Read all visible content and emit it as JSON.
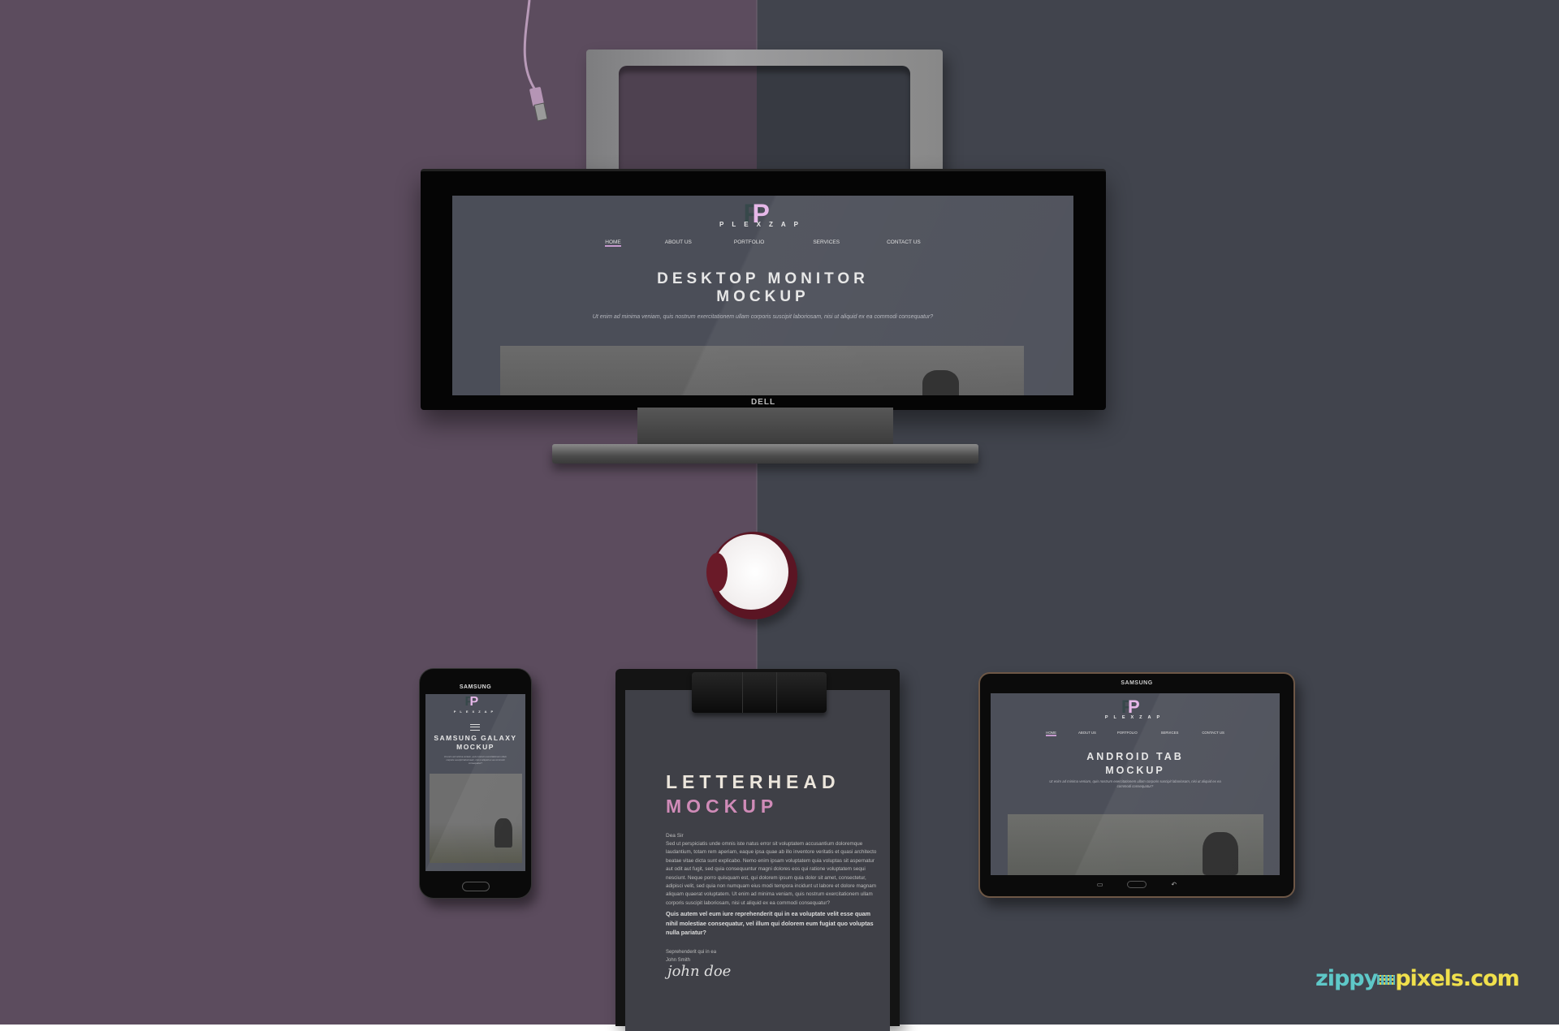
{
  "background": {
    "left_color": "#5c4c5e",
    "right_color": "#41444d"
  },
  "brand": {
    "name": "PLEXZAP",
    "logo_letter": "P",
    "accent": "#e6b7e8"
  },
  "nav": [
    "HOME",
    "ABOUT US",
    "PORTFOLIO",
    "SERVICES",
    "CONTACT US"
  ],
  "monitor": {
    "maker": "DELL",
    "title_line1": "DESKTOP MONITOR",
    "title_line2": "MOCKUP",
    "subtitle": "Ut enim ad minima veniam, quis nostrum exercitationem ullam corporis suscipit laboriosam, nisi ut aliquid ex ea commodi consequatur?"
  },
  "phone": {
    "maker": "SAMSUNG",
    "title_line1": "SAMSUNG GALAXY",
    "title_line2": "MOCKUP",
    "subtitle": "Ut enim ad minima veniam, quis nostrum exercitationem ullam corporis suscipit laboriosam, nisi ut aliquid ex ea commodi consequatur?"
  },
  "tablet": {
    "maker": "SAMSUNG",
    "title_line1": "ANDROID TAB",
    "title_line2": "MOCKUP",
    "subtitle": "Ut enim ad minima veniam, quis nostrum exercitationem ullam corporis suscipit laboriosam, nisi ut aliquid ex ea commodi consequatur?"
  },
  "letterhead": {
    "title_line1": "LETTERHEAD",
    "title_line2": "MOCKUP",
    "greeting": "Dea Sir",
    "body": "Sed ut perspiciatis unde omnis iste natus error sit voluptatem accusantium doloremque laudantium, totam rem aperiam, eaque ipsa quae ab illo inventore veritatis et quasi architecto beatae vitae dicta sunt explicabo. Nemo enim ipsam voluptatem quia voluptas sit aspernatur aut odit aut fugit, sed quia consequuntur magni dolores eos qui ratione voluptatem sequi nesciunt. Neque porro quisquam est, qui dolorem ipsum quia dolor sit amet, consectetur, adipisci velit, sed quia non numquam eius modi tempora incidunt ut labore et dolore magnam aliquam quaerat voluptatem. Ut enim ad minima veniam, quis nostrum exercitationem ullam corporis suscipit laboriosam, nisi ut aliquid ex ea commodi consequatur?",
    "bold_paragraph": "Quis autem vel eum iure reprehenderit qui in ea voluptate velit esse quam nihil molestiae consequatur, vel illum qui dolorem eum fugiat quo voluptas nulla pariatur?",
    "closing": "Seprehenderit qui in ea",
    "name": "John Smith",
    "signature": "john doe"
  },
  "watermark": {
    "part1": "zippy",
    "part2": "pixels.com"
  }
}
